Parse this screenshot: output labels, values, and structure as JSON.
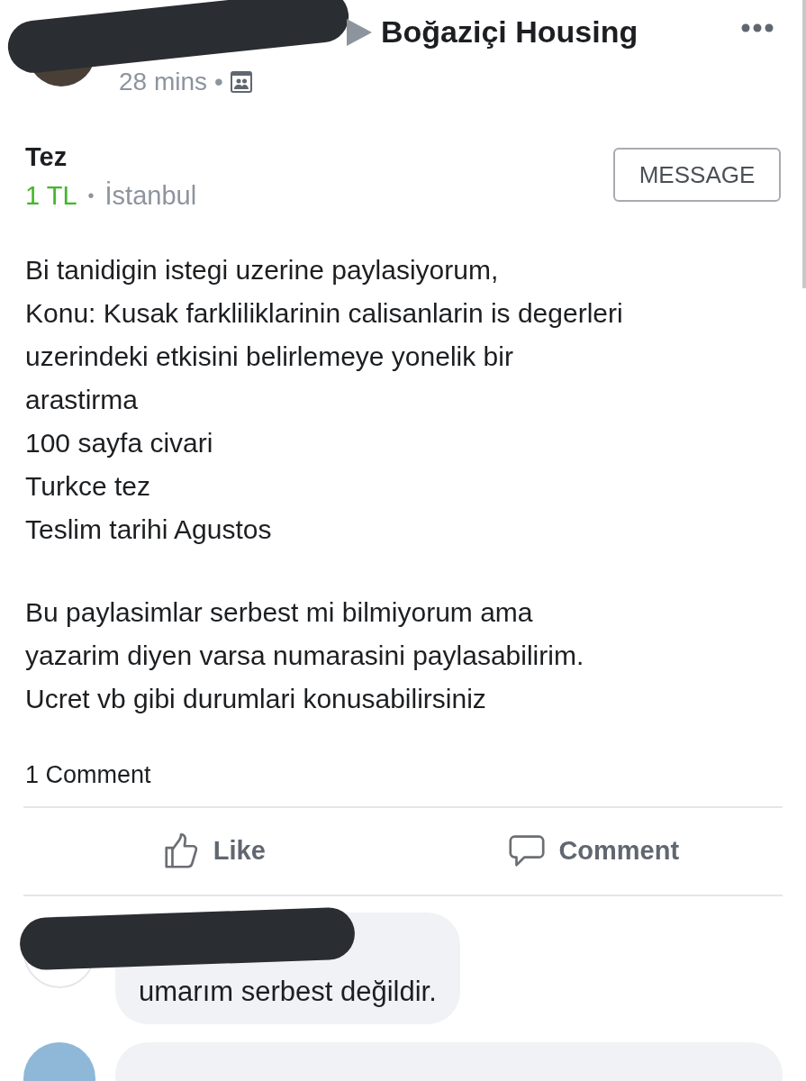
{
  "header": {
    "group": "Boğaziçi Housing",
    "time": "28 mins",
    "separator": "•"
  },
  "listing": {
    "title": "Tez",
    "price": "1 TL",
    "separator": "•",
    "location": "İstanbul",
    "button": "MESSAGE"
  },
  "body": [
    [
      "Bi tanidigin istegi uzerine paylasiyorum,",
      "Konu: Kusak farkliliklarinin calisanlarin is degerleri",
      "uzerindeki etkisini belirlemeye yonelik bir",
      "arastirma",
      "100 sayfa civari",
      "Turkce tez",
      "Teslim tarihi Agustos"
    ],
    [
      "Bu paylasimlar serbest mi bilmiyorum ama",
      "yazarim diyen varsa numarasini paylasabilirim.",
      "Ucret vb gibi durumlari konusabilirsiniz"
    ]
  ],
  "comment_count": "1 Comment",
  "actions": [
    {
      "kind": "like",
      "label": "Like"
    },
    {
      "kind": "comment",
      "label": "Comment"
    }
  ],
  "comments": [
    {
      "text": "umarım serbest değildir."
    }
  ]
}
